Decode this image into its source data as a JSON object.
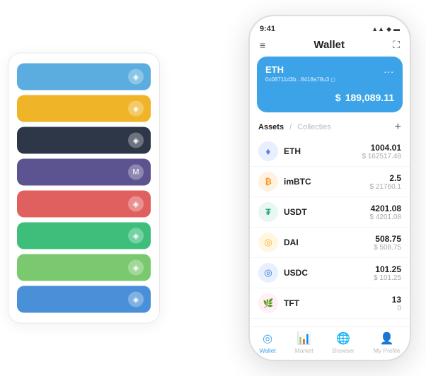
{
  "scene": {
    "left_panel": {
      "cards": [
        {
          "id": "card-1",
          "color": "card-row-1",
          "icon": "◈"
        },
        {
          "id": "card-2",
          "color": "card-row-2",
          "icon": "◈"
        },
        {
          "id": "card-3",
          "color": "card-row-3",
          "icon": "◈"
        },
        {
          "id": "card-4",
          "color": "card-row-4",
          "icon": "M"
        },
        {
          "id": "card-5",
          "color": "card-row-5",
          "icon": "◈"
        },
        {
          "id": "card-6",
          "color": "card-row-6",
          "icon": "◈"
        },
        {
          "id": "card-7",
          "color": "card-row-7",
          "icon": "◈"
        },
        {
          "id": "card-8",
          "color": "card-row-8",
          "icon": "◈"
        }
      ]
    },
    "phone": {
      "status_time": "9:41",
      "status_icons": "▲▲ ◆",
      "header_title": "Wallet",
      "eth_card": {
        "label": "ETH",
        "address": "0x08711d3b...8418a78u3 ◻",
        "more": "...",
        "balance_symbol": "$",
        "balance": "189,089.11"
      },
      "assets_section": {
        "tab_active": "Assets",
        "tab_slash": "/",
        "tab_inactive": "Collecties",
        "add_icon": "+"
      },
      "assets": [
        {
          "id": "eth",
          "name": "ETH",
          "icon": "♦",
          "icon_class": "icon-eth",
          "amount": "1004.01",
          "sub_amount": "$ 162517.48"
        },
        {
          "id": "imbtc",
          "name": "imBTC",
          "icon": "₿",
          "icon_class": "icon-imbtc",
          "amount": "2.5",
          "sub_amount": "$ 21760.1"
        },
        {
          "id": "usdt",
          "name": "USDT",
          "icon": "₮",
          "icon_class": "icon-usdt",
          "amount": "4201.08",
          "sub_amount": "$ 4201.08"
        },
        {
          "id": "dai",
          "name": "DAI",
          "icon": "◉",
          "icon_class": "icon-dai",
          "amount": "508.75",
          "sub_amount": "$ 508.75"
        },
        {
          "id": "usdc",
          "name": "USDC",
          "icon": "◎",
          "icon_class": "icon-usdc",
          "amount": "101.25",
          "sub_amount": "$ 101.25"
        },
        {
          "id": "tft",
          "name": "TFT",
          "icon": "🌿",
          "icon_class": "icon-tft",
          "amount": "13",
          "sub_amount": "0"
        }
      ],
      "nav": {
        "items": [
          {
            "id": "wallet",
            "label": "Wallet",
            "icon": "◎",
            "active": true
          },
          {
            "id": "market",
            "label": "Market",
            "icon": "📈",
            "active": false
          },
          {
            "id": "browser",
            "label": "Browser",
            "icon": "◎",
            "active": false
          },
          {
            "id": "profile",
            "label": "My Profile",
            "icon": "👤",
            "active": false
          }
        ]
      }
    }
  }
}
